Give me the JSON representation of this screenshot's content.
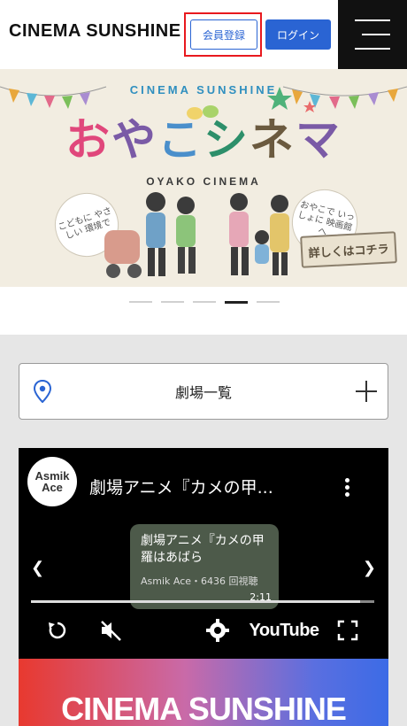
{
  "header": {
    "logo": "CINEMA SUNSHINE",
    "register_label": "会員登録",
    "login_label": "ログイン",
    "menu_icon": "hamburger-icon"
  },
  "banner": {
    "subtitle": "CINEMA SUNSHINE",
    "title_parts": [
      "お",
      "や",
      "こ",
      "シ",
      "ネ",
      "マ"
    ],
    "romaji": "OYAKO CINEMA",
    "bubble_left": "こどもに やさしい 環境で",
    "bubble_right": "おやこで いっしょに 映画館へ",
    "signboard": "詳しくはコチラ"
  },
  "carousel": {
    "slide_count": 5,
    "active_index": 3
  },
  "theater_list": {
    "label": "劇場一覧",
    "pin_icon": "location-pin-icon",
    "expand_icon": "plus-icon"
  },
  "video": {
    "channel_avatar_text": "Asmik Ace",
    "title": "劇場アニメ『カメの甲...",
    "thumb_title": "劇場アニメ『カメの甲羅はあばら",
    "thumb_meta": "Asmik Ace・6436 回視聴",
    "thumb_time": "2:11",
    "progress": 0.96,
    "youtube_label": "YouTube"
  },
  "promo": {
    "text": "CINEMA SUNSHINE"
  }
}
